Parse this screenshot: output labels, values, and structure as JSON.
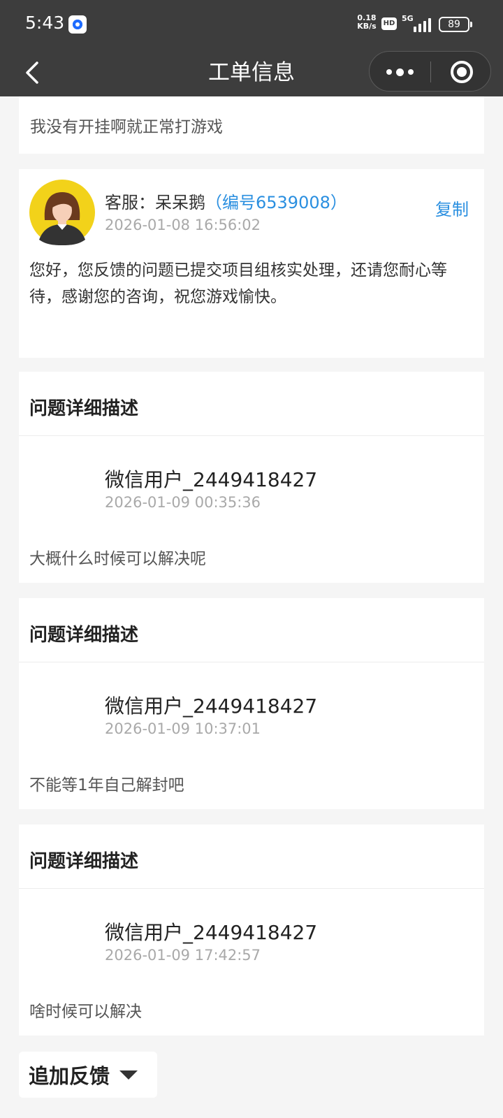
{
  "status_bar": {
    "time": "5:43",
    "net_speed_value": "0.18",
    "net_speed_unit": "KB/s",
    "hd_badge": "HD",
    "network": "5G",
    "battery": "89"
  },
  "nav": {
    "title": "工单信息"
  },
  "partial_message": {
    "text": "我没有开挂啊就正常打游戏"
  },
  "agent_reply": {
    "name_prefix": "客服：呆呆鹅",
    "agent_id": "（编号6539008）",
    "time": "2026-01-08 16:56:02",
    "copy_label": "复制",
    "message": "您好，您反馈的问题已提交项目组核实处理，还请您耐心等待，感谢您的咨询，祝您游戏愉快。"
  },
  "descriptions": [
    {
      "title": "问题详细描述",
      "user": "微信用户_2449418427",
      "time": "2026-01-09 00:35:36",
      "message": "大概什么时候可以解决呢"
    },
    {
      "title": "问题详细描述",
      "user": "微信用户_2449418427",
      "time": "2026-01-09 10:37:01",
      "message": "不能等1年自己解封吧"
    },
    {
      "title": "问题详细描述",
      "user": "微信用户_2449418427",
      "time": "2026-01-09 17:42:57",
      "message": "啥时候可以解决"
    }
  ],
  "footer": {
    "add_feedback_label": "追加反馈"
  },
  "colors": {
    "accent": "#2a8fe0",
    "header_bg": "#3d3d3d",
    "page_bg": "#f5f5f5"
  }
}
